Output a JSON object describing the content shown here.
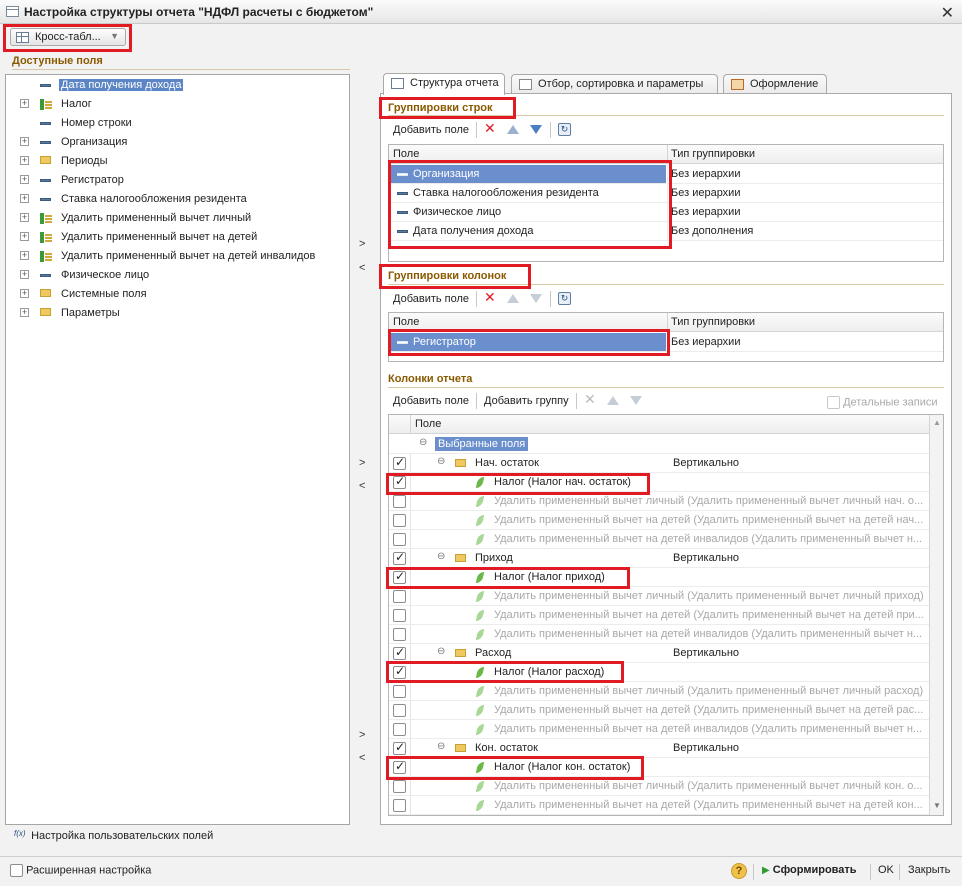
{
  "window": {
    "title": "Настройка структуры отчета \"НДФЛ расчеты с бюджетом\"",
    "close_glyph": "✕"
  },
  "mode_button": {
    "label": "Кросс-табл..."
  },
  "available_fields": {
    "title": "Доступные поля",
    "items": [
      {
        "label": "Дата получения дохода",
        "icon": "dash-icon",
        "expandable": false,
        "selected": true
      },
      {
        "label": "Налог",
        "icon": "resource-icon",
        "expandable": true
      },
      {
        "label": "Номер строки",
        "icon": "dash-icon",
        "expandable": false
      },
      {
        "label": "Организация",
        "icon": "dash-icon",
        "expandable": true
      },
      {
        "label": "Периоды",
        "icon": "folder-icon",
        "expandable": true
      },
      {
        "label": "Регистратор",
        "icon": "dash-icon",
        "expandable": true
      },
      {
        "label": "Ставка налогообложения резидента",
        "icon": "dash-icon",
        "expandable": true
      },
      {
        "label": "Удалить примененный вычет личный",
        "icon": "resource-icon",
        "expandable": true
      },
      {
        "label": "Удалить примененный вычет на детей",
        "icon": "resource-icon",
        "expandable": true
      },
      {
        "label": "Удалить примененный вычет на детей инвалидов",
        "icon": "resource-icon",
        "expandable": true
      },
      {
        "label": "Физическое лицо",
        "icon": "dash-icon",
        "expandable": true
      },
      {
        "label": "Системные поля",
        "icon": "folder-icon",
        "expandable": true
      },
      {
        "label": "Параметры",
        "icon": "folder-icon",
        "expandable": true
      }
    ],
    "custom_fields_link": "Настройка пользовательских полей"
  },
  "arrows": {
    "add": ">",
    "remove": "<"
  },
  "tabs": [
    {
      "label": "Структура отчета",
      "active": true
    },
    {
      "label": "Отбор, сортировка и параметры",
      "active": false
    },
    {
      "label": "Оформление",
      "active": false
    }
  ],
  "row_groupings": {
    "title": "Группировки строк",
    "add_label": "Добавить поле",
    "col_field": "Поле",
    "col_type": "Тип группировки",
    "rows": [
      {
        "field": "Организация",
        "type": "Без иерархии",
        "selected": true
      },
      {
        "field": "Ставка налогообложения резидента",
        "type": "Без иерархии"
      },
      {
        "field": "Физическое лицо",
        "type": "Без иерархии"
      },
      {
        "field": "Дата получения дохода",
        "type": "Без дополнения"
      }
    ]
  },
  "column_groupings": {
    "title": "Группировки колонок",
    "add_label": "Добавить поле",
    "col_field": "Поле",
    "col_type": "Тип группировки",
    "rows": [
      {
        "field": "Регистратор",
        "type": "Без иерархии",
        "selected": true
      }
    ]
  },
  "report_columns": {
    "title": "Колонки отчета",
    "add_field_label": "Добавить поле",
    "add_group_label": "Добавить группу",
    "detail_records_label": "Детальные записи",
    "col_field": "Поле",
    "root_label": "Выбранные поля",
    "rows": [
      {
        "kind": "group",
        "label": "Нач. остаток",
        "layout": "Вертикально",
        "checked": true
      },
      {
        "kind": "item",
        "label": "Налог (Налог нач. остаток)",
        "checked": true
      },
      {
        "kind": "item",
        "label": "Удалить примененный вычет личный (Удалить примененный вычет личный нач. о...",
        "checked": false
      },
      {
        "kind": "item",
        "label": "Удалить примененный вычет на детей (Удалить примененный вычет на детей нач...",
        "checked": false
      },
      {
        "kind": "item",
        "label": "Удалить примененный вычет на детей инвалидов (Удалить примененный вычет н...",
        "checked": false
      },
      {
        "kind": "group",
        "label": "Приход",
        "layout": "Вертикально",
        "checked": true
      },
      {
        "kind": "item",
        "label": "Налог (Налог приход)",
        "checked": true
      },
      {
        "kind": "item",
        "label": "Удалить примененный вычет личный (Удалить примененный вычет личный приход)",
        "checked": false
      },
      {
        "kind": "item",
        "label": "Удалить примененный вычет на детей (Удалить примененный вычет на детей при...",
        "checked": false
      },
      {
        "kind": "item",
        "label": "Удалить примененный вычет на детей инвалидов (Удалить примененный вычет н...",
        "checked": false
      },
      {
        "kind": "group",
        "label": "Расход",
        "layout": "Вертикально",
        "checked": true
      },
      {
        "kind": "item",
        "label": "Налог (Налог расход)",
        "checked": true
      },
      {
        "kind": "item",
        "label": "Удалить примененный вычет личный (Удалить примененный вычет личный расход)",
        "checked": false
      },
      {
        "kind": "item",
        "label": "Удалить примененный вычет на детей (Удалить примененный вычет на детей рас...",
        "checked": false
      },
      {
        "kind": "item",
        "label": "Удалить примененный вычет на детей инвалидов (Удалить примененный вычет н...",
        "checked": false
      },
      {
        "kind": "group",
        "label": "Кон. остаток",
        "layout": "Вертикально",
        "checked": true
      },
      {
        "kind": "item",
        "label": "Налог (Налог кон. остаток)",
        "checked": true
      },
      {
        "kind": "item",
        "label": "Удалить примененный вычет личный (Удалить примененный вычет личный кон. о...",
        "checked": false
      },
      {
        "kind": "item",
        "label": "Удалить примененный вычет на детей (Удалить примененный вычет на детей кон...",
        "checked": false
      }
    ]
  },
  "footer": {
    "extended_settings_label": "Расширенная настройка",
    "help_glyph": "?",
    "generate_label": "Сформировать",
    "ok_label": "OK",
    "close_label": "Закрыть"
  },
  "colors": {
    "highlight": "#e01b24",
    "selection": "#6b8fcc",
    "section_title": "#8a5a00"
  }
}
